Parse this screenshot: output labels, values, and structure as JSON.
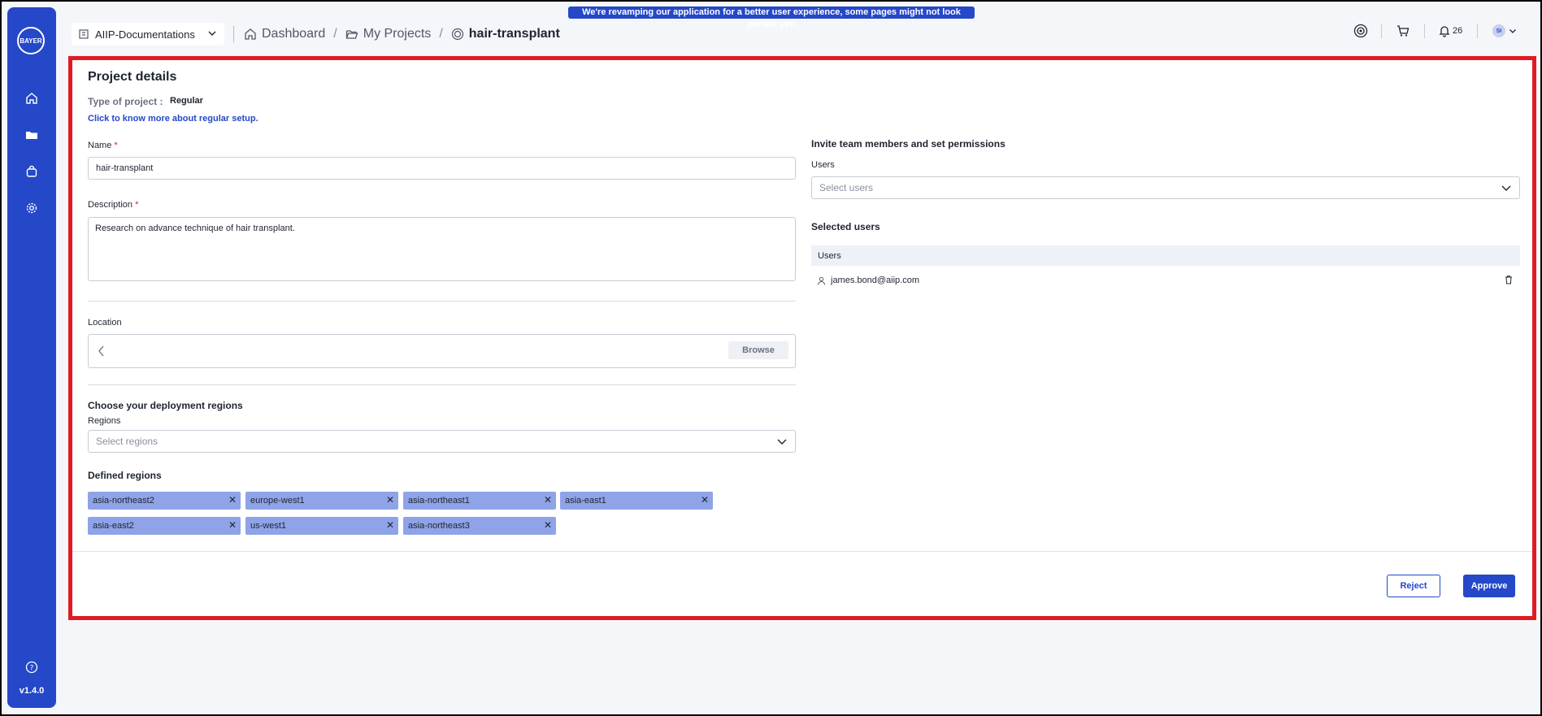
{
  "banner": "We're revamping our application for a better user experience, some pages might not look perfect yet!",
  "sidebar": {
    "logo_text": "BAYER",
    "items": [
      {
        "icon": "home-icon"
      },
      {
        "icon": "folder-icon"
      },
      {
        "icon": "shopping-bag-icon"
      },
      {
        "icon": "gear-icon"
      }
    ],
    "help_icon": "help-icon",
    "version": "v1.4.0"
  },
  "header": {
    "workspace": "AIIP-Documentations",
    "breadcrumbs": [
      "Dashboard",
      "My Projects",
      "hair-transplant"
    ],
    "notifications_count": "26",
    "avatar_initials": "SI"
  },
  "project": {
    "title": "Project details",
    "type_label": "Type of project :",
    "type_value": "Regular",
    "learn_more": "Click to know more about regular setup.",
    "name_label": "Name",
    "name_value": "hair-transplant",
    "description_label": "Description",
    "description_value": "Research on advance technique of hair transplant.",
    "location_label": "Location",
    "browse_label": "Browse",
    "regions_title": "Choose your deployment regions",
    "regions_label": "Regions",
    "regions_placeholder": "Select regions",
    "defined_regions_title": "Defined regions",
    "defined_regions": [
      "asia-northeast2",
      "europe-west1",
      "asia-northeast1",
      "asia-east1",
      "asia-east2",
      "us-west1",
      "asia-northeast3"
    ]
  },
  "team": {
    "title": "Invite team members and set permissions",
    "users_label": "Users",
    "users_placeholder": "Select users",
    "selected_title": "Selected users",
    "table_header": "Users",
    "users": [
      "james.bond@aiip.com"
    ]
  },
  "actions": {
    "reject": "Reject",
    "approve": "Approve"
  },
  "colors": {
    "accent": "#2448c8",
    "highlight_border": "#e01b22",
    "chip": "#8fa3e8"
  }
}
